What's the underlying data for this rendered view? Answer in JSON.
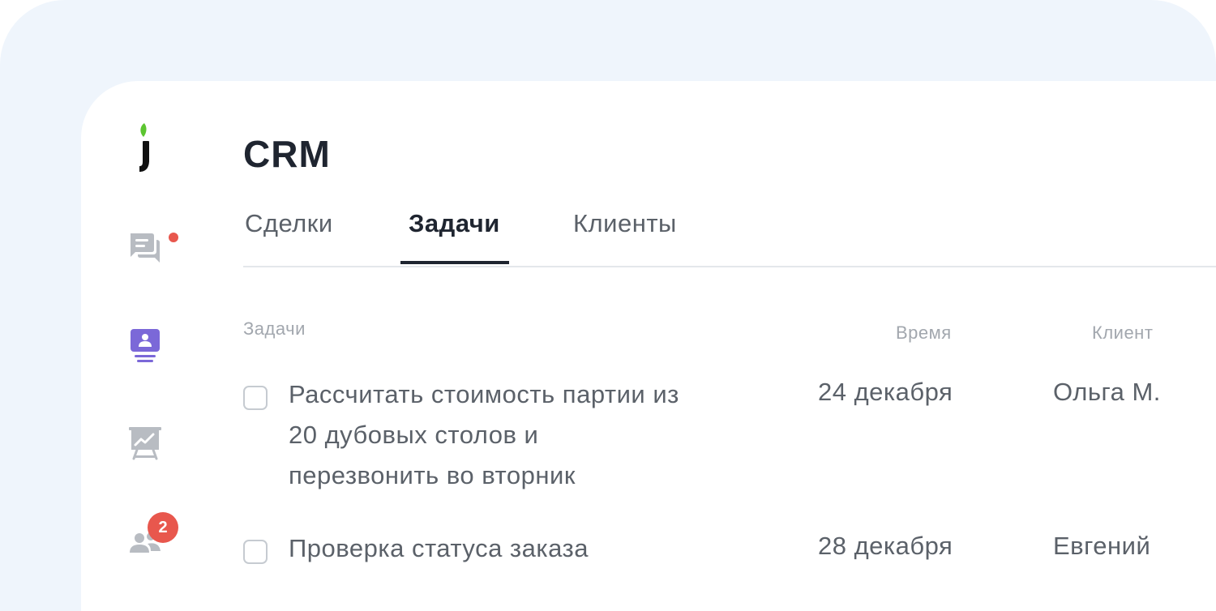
{
  "header": {
    "title": "CRM"
  },
  "tabs": [
    {
      "label": "Сделки",
      "active": false
    },
    {
      "label": "Задачи",
      "active": true
    },
    {
      "label": "Клиенты",
      "active": false
    }
  ],
  "sidebar": {
    "items": [
      {
        "icon": "chat-icon",
        "has_notification_dot": true
      },
      {
        "icon": "crm-contact-icon",
        "active": true
      },
      {
        "icon": "analytics-board-icon"
      },
      {
        "icon": "users-icon",
        "badge": "2"
      }
    ]
  },
  "table": {
    "headers": {
      "task": "Задачи",
      "time": "Время",
      "client": "Клиент"
    },
    "rows": [
      {
        "task": "Рассчитать стоимость партии из 20 дубовых столов и перезвонить во вторник",
        "time": "24 декабря",
        "client": "Ольга М.",
        "checked": false
      },
      {
        "task": "Проверка статуса заказа",
        "time": "28 декабря",
        "client": "Евгений",
        "checked": false
      }
    ]
  },
  "colors": {
    "accent": "#7b68d8",
    "dark": "#1f2530",
    "badge": "#e8574d",
    "logo_leaf": "#5cc530",
    "background": "#eff5fc"
  }
}
